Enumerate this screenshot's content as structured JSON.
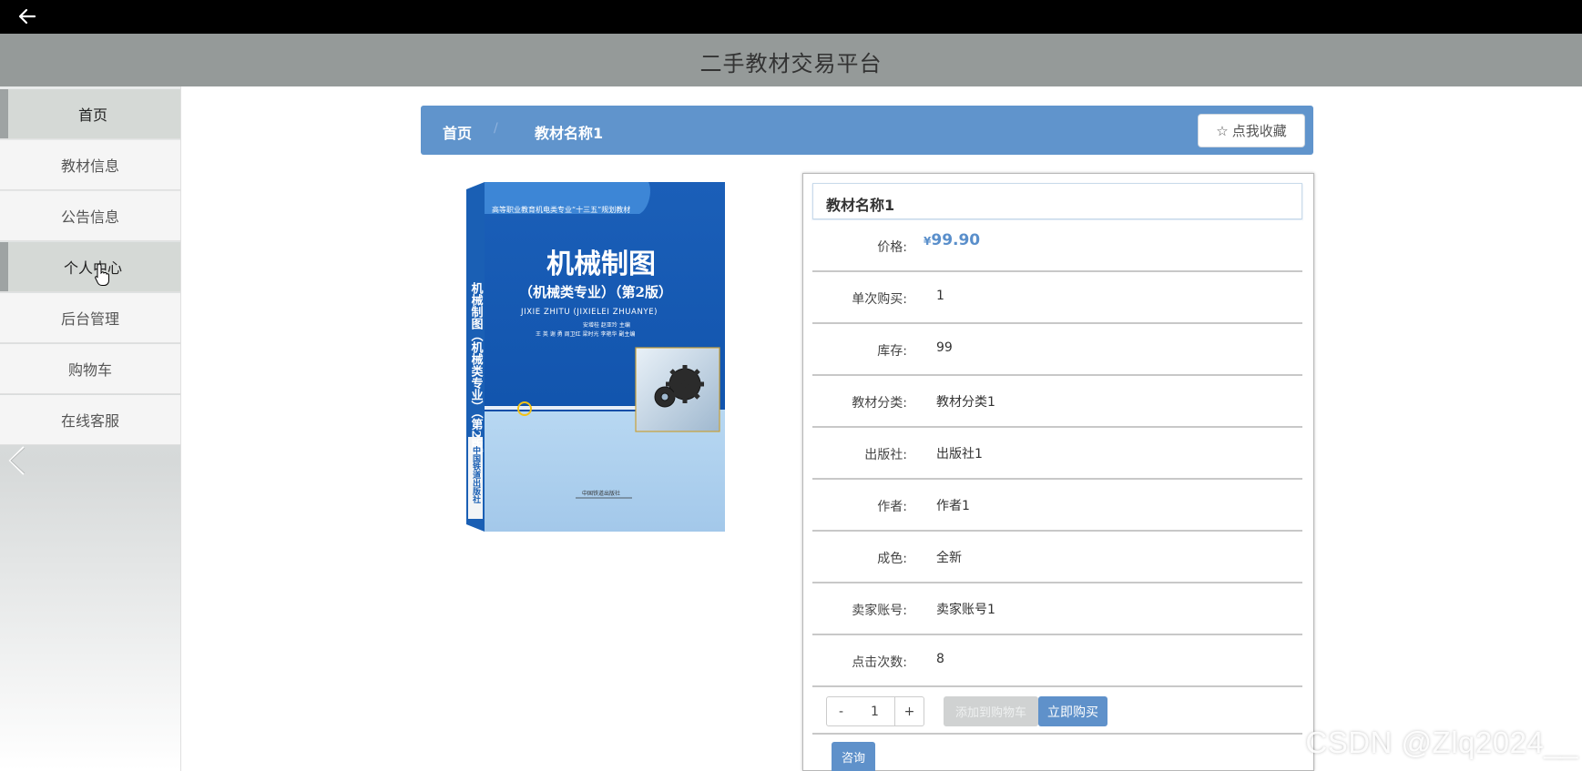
{
  "header": {
    "title": "二手教材交易平台"
  },
  "sidebar": {
    "items": [
      {
        "label": "首页",
        "active": true
      },
      {
        "label": "教材信息",
        "active": false
      },
      {
        "label": "公告信息",
        "active": false
      },
      {
        "label": "个人中心",
        "active": true
      },
      {
        "label": "后台管理",
        "active": false
      },
      {
        "label": "购物车",
        "active": false
      },
      {
        "label": "在线客服",
        "active": false
      }
    ]
  },
  "breadcrumb": {
    "home": "首页",
    "separator": "/",
    "current": "教材名称1"
  },
  "favorite": {
    "label": "点我收藏",
    "icon": "star-outline-icon"
  },
  "book": {
    "series": "高等职业教育机电类专业“十三五”规划教材",
    "title": "机械制图",
    "subtitle": "（机械类专业）（第2版）",
    "pinyin": "JIXIE ZHITU (JIXIELEI ZHUANYE)",
    "editors": "安增桂 赵亚玲 主编",
    "assoc_editors": "王 英 谢 勇 周卫红 梁时光 李艳华 副主编",
    "spine": "机械制图（机械类专业）（第2版）",
    "spine_publisher": "中国铁道出版社",
    "publisher": "中国铁道出版社"
  },
  "detail": {
    "title": "教材名称1",
    "price_label": "价格:",
    "currency": "¥",
    "price": "99.90",
    "rows": [
      {
        "label": "单次购买:",
        "value": "1"
      },
      {
        "label": "库存:",
        "value": "99"
      },
      {
        "label": "教材分类:",
        "value": "教材分类1"
      },
      {
        "label": "出版社:",
        "value": "出版社1"
      },
      {
        "label": "作者:",
        "value": "作者1"
      },
      {
        "label": "成色:",
        "value": "全新"
      },
      {
        "label": "卖家账号:",
        "value": "卖家账号1"
      },
      {
        "label": "点击次数:",
        "value": "8"
      }
    ],
    "qty": {
      "minus": "-",
      "value": "1",
      "plus": "+"
    },
    "add_to_cart": "添加到购物车",
    "buy_now": "立即购买",
    "consult": "咨询"
  },
  "watermark": "CSDN @Zlq2024__",
  "colors": {
    "accent": "#6094cc",
    "title_bar": "#959a99",
    "price": "#5a8fcb"
  }
}
